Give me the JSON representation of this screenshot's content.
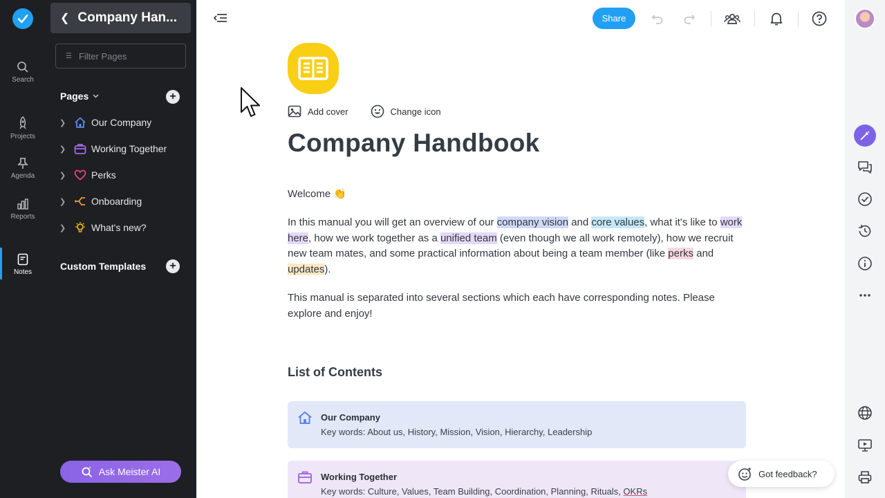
{
  "rail": {
    "items": [
      {
        "label": "Search",
        "icon": "search-icon"
      },
      {
        "label": "Projects",
        "icon": "rocket-icon"
      },
      {
        "label": "Agenda",
        "icon": "pin-icon"
      },
      {
        "label": "Reports",
        "icon": "bar-chart-icon"
      },
      {
        "label": "Notes",
        "icon": "note-icon",
        "active": true
      }
    ]
  },
  "sidebar": {
    "title": "Company Han...",
    "filter_placeholder": "Filter Pages",
    "pages_label": "Pages",
    "pages": [
      {
        "label": "Our Company",
        "icon": "home-icon"
      },
      {
        "label": "Working Together",
        "icon": "briefcase-icon"
      },
      {
        "label": "Perks",
        "icon": "heart-icon"
      },
      {
        "label": "Onboarding",
        "icon": "flow-icon"
      },
      {
        "label": "What's new?",
        "icon": "lightbulb-icon"
      }
    ],
    "custom_templates_label": "Custom Templates",
    "ask_ai_label": "Ask Meister AI"
  },
  "topbar": {
    "share_label": "Share"
  },
  "document": {
    "add_cover": "Add cover",
    "change_icon": "Change icon",
    "title": "Company Handbook",
    "welcome": "Welcome 👏",
    "p1": {
      "a": "In this manual you will get an overview of our ",
      "hl1": "company vision",
      "b": " and ",
      "hl2": "core values",
      "c": ", what it's like to ",
      "hl3": "work here",
      "d": ", how we work together as a ",
      "hl4": "unified team",
      "e": " (even though we all work remotely), how we recruit new team mates, and some practical information about being a team member (like ",
      "hl5": "perks",
      "f": " and ",
      "hl6": "updates",
      "g": ")."
    },
    "p2": "This manual is separated into several sections which each have corresponding notes. Please explore and enjoy!",
    "toc_title": "List of Contents",
    "toc": [
      {
        "title": "Our Company",
        "keywords": "Key words: About us, History, Mission, Vision, Hierarchy, Leadership",
        "color": "#e3e8f9"
      },
      {
        "title": "Working Together",
        "keywords_prefix": "Key words: Culture, Values, Team Building, Coordination, Planning, Rituals, ",
        "keywords_link": "OKRs",
        "color": "#efe7f8"
      }
    ]
  },
  "feedback_label": "Got feedback?",
  "colors": {
    "accent": "#21a0f3",
    "sidebar_bg": "#1d1f23",
    "note_icon_bg": "#f8cf15",
    "ai_purple": "#7c63e6"
  }
}
